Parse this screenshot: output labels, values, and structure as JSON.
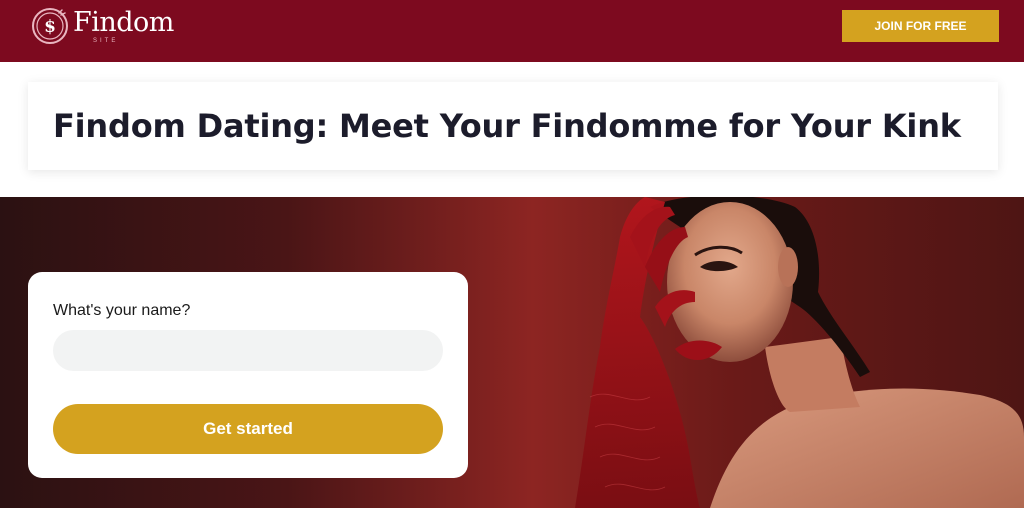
{
  "header": {
    "logo_text": "Findom",
    "logo_subtext": "SITE",
    "join_label": "JOIN FOR FREE",
    "logo_icon": "dollar-coin-icon"
  },
  "title_section": {
    "heading": "Findom Dating: Meet Your Findomme for Your Kink"
  },
  "signup_form": {
    "name_label": "What's your name?",
    "name_value": "",
    "name_placeholder": "",
    "submit_label": "Get started"
  },
  "hero": {
    "image": "woman-in-red-lace-gloves-photo"
  },
  "colors": {
    "header_bg": "#7d0a1f",
    "accent_gold": "#d4a21f",
    "heading_text": "#1c1c2b",
    "input_bg": "#f2f3f3"
  }
}
